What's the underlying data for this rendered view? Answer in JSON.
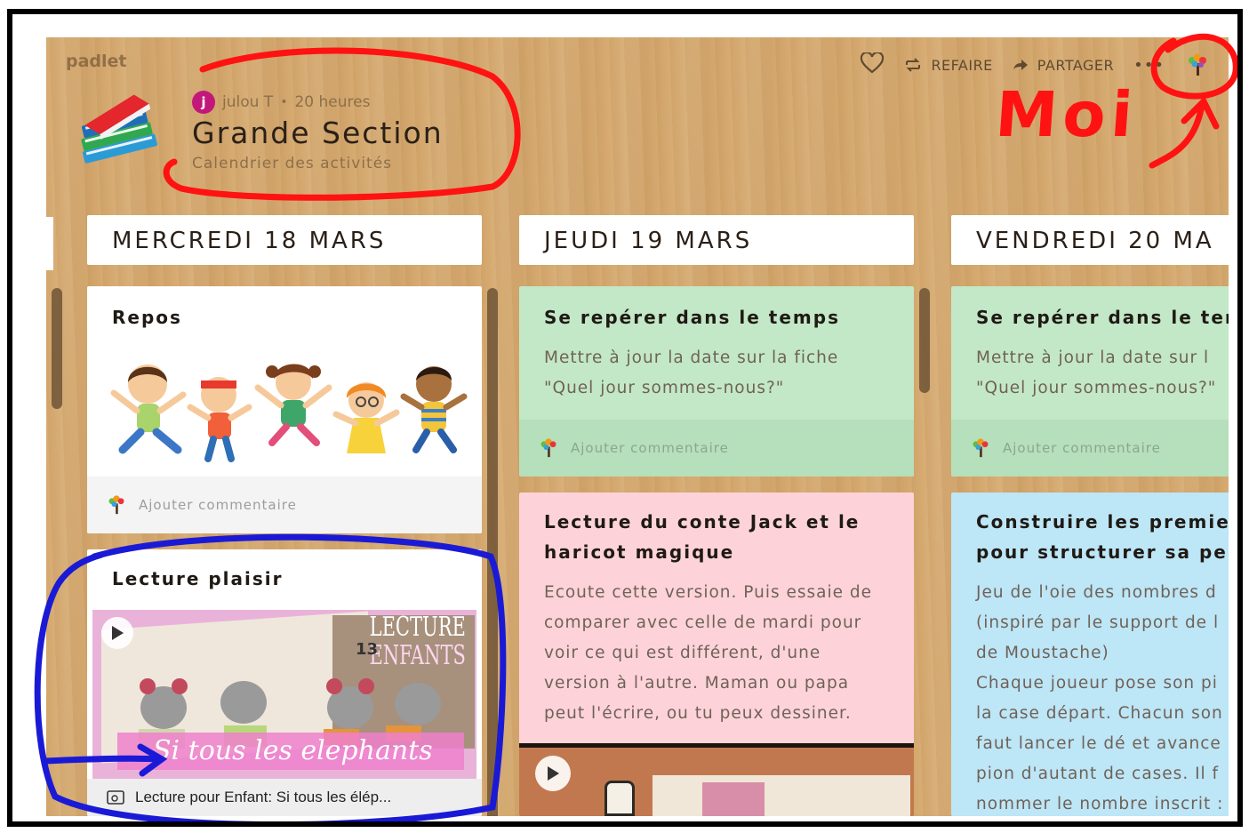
{
  "app": {
    "brand": "padlet"
  },
  "header": {
    "author_initial": "j",
    "author_name": "julou T",
    "time_ago": "20 heures",
    "title": "Grande Section",
    "subtitle": "Calendrier des activités"
  },
  "actions": {
    "redo_label": "REFAIRE",
    "share_label": "PARTAGER",
    "more_label": "•••"
  },
  "annotation": {
    "moi": "Moi"
  },
  "columns": [
    {
      "header": "MERCREDI 18 MARS",
      "posts": [
        {
          "title": "Repos",
          "comment_placeholder": "Ajouter commentaire"
        },
        {
          "title": "Lecture plaisir",
          "video_caption_1": "LECTURE",
          "video_caption_2": "ENFANTS",
          "video_number": "13",
          "video_banner": "Si tous les elephants",
          "link_title": "Lecture pour Enfant: Si tous les élép..."
        }
      ]
    },
    {
      "header": "JEUDI 19 MARS",
      "posts": [
        {
          "title": "Se repérer dans le temps",
          "body_1": "Mettre à jour la date  sur la fiche",
          "body_2": "\"Quel jour sommes-nous?\"",
          "comment_placeholder": "Ajouter commentaire"
        },
        {
          "title_1": "Lecture du conte Jack et le",
          "title_2": "haricot magique",
          "body": [
            "Ecoute cette version. Puis essaie de",
            "comparer avec celle de mardi pour",
            "voir ce qui est différent, d'une",
            "version à l'autre. Maman ou papa",
            "peut l'écrire, ou tu peux dessiner."
          ]
        }
      ]
    },
    {
      "header": "VENDREDI 20 MA",
      "posts": [
        {
          "title": "Se repérer dans le ten",
          "body_1": "Mettre à jour la date  sur l",
          "body_2": "\"Quel jour sommes-nous?\"",
          "comment_placeholder": "Ajouter commentaire"
        },
        {
          "title_1": "Construire les premier",
          "title_2": "pour structurer sa per",
          "body": [
            "Jeu de l'oie des nombres d",
            "(inspiré par le support de l",
            "de Moustache)",
            "Chaque joueur pose son pi",
            "la case départ. Chacun son",
            "faut lancer le dé et avance",
            "pion d'autant de cases. Il f",
            "nommer le nombre inscrit :"
          ]
        }
      ]
    }
  ],
  "colors": {
    "wood": "#d4a86e",
    "green_card": "#c3e8c8",
    "pink_card": "#fdd3d9",
    "blue_card": "#bde6f7",
    "annotation_red": "#ff1212",
    "annotation_blue": "#1a1ad6"
  }
}
